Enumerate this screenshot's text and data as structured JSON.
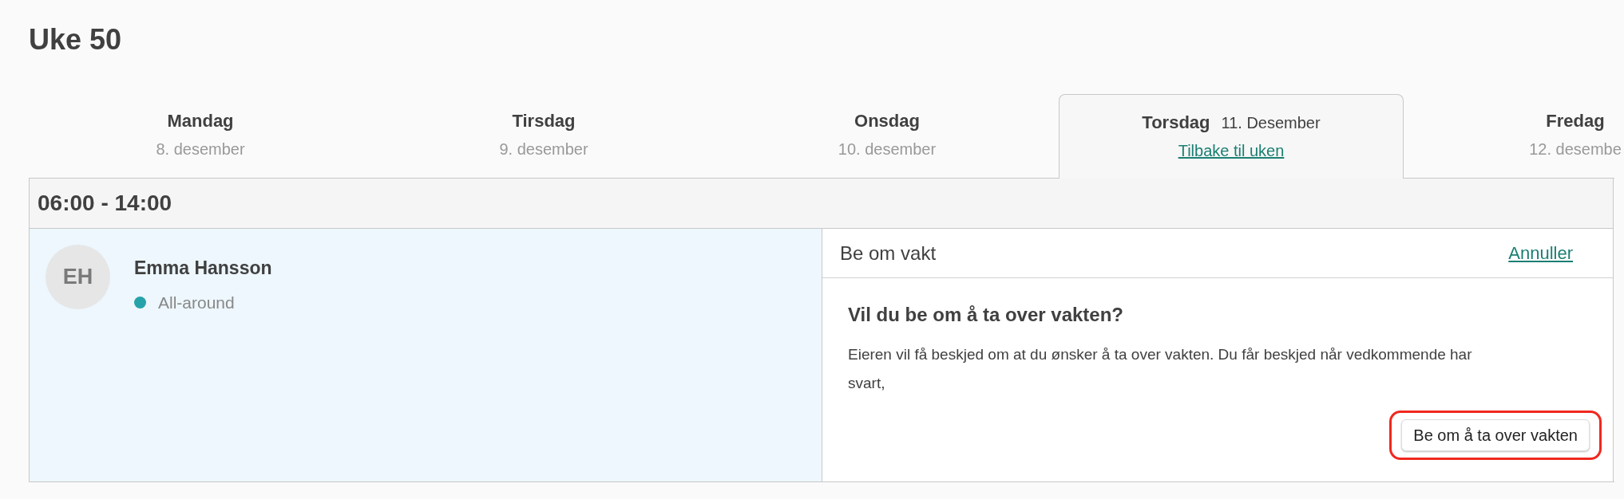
{
  "title": "Uke 50",
  "days": [
    {
      "name": "Mandag",
      "date": "8. desember",
      "selected": false
    },
    {
      "name": "Tirsdag",
      "date": "9. desember",
      "selected": false
    },
    {
      "name": "Onsdag",
      "date": "10. desember",
      "selected": false
    },
    {
      "name": "Torsdag",
      "date": "11. Desember",
      "selected": true,
      "link": "Tilbake til uken"
    },
    {
      "name": "Fredag",
      "date": "12. desembe",
      "selected": false
    }
  ],
  "shift": {
    "time": "06:00 - 14:00",
    "employee": {
      "initials": "EH",
      "name": "Emma Hansson",
      "role": "All-around",
      "color": "#26a3a8"
    },
    "panel": {
      "title": "Be om vakt",
      "cancel": "Annuller",
      "question": "Vil du be om å ta over vakten?",
      "text": "Eieren vil få beskjed om at du ønsker å ta over vakten. Du får beskjed når vedkommende har svart,",
      "button": "Be om å ta over vakten",
      "highlighted": true
    }
  }
}
